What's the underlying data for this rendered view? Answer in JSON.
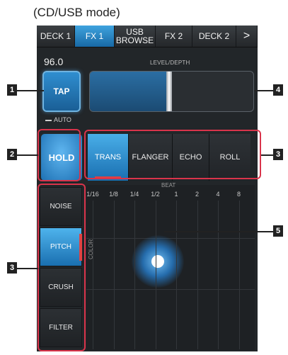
{
  "caption": "(CD/USB mode)",
  "tabs": [
    {
      "label": "DECK 1"
    },
    {
      "label": "FX 1"
    },
    {
      "label": "USB BROWSE"
    },
    {
      "label": "FX 2"
    },
    {
      "label": "DECK 2"
    },
    {
      "label": ">"
    }
  ],
  "bpm": "96.0",
  "tap_label": "TAP",
  "auto_label": "AUTO",
  "level_depth": {
    "label": "LEVEL/DEPTH",
    "value_fraction": 0.47
  },
  "hold_label": "HOLD",
  "fx_types": [
    {
      "label": "TRANS",
      "active": true
    },
    {
      "label": "FLANGER",
      "active": false
    },
    {
      "label": "ECHO",
      "active": false
    },
    {
      "label": "ROLL",
      "active": false
    }
  ],
  "side_fx": [
    {
      "label": "NOISE",
      "active": false
    },
    {
      "label": "PITCH",
      "active": true
    },
    {
      "label": "CRUSH",
      "active": false
    },
    {
      "label": "FILTER",
      "active": false
    }
  ],
  "beat_label": "BEAT",
  "beats": [
    "1/16",
    "1/8",
    "1/4",
    "1/2",
    "1",
    "2",
    "4",
    "8"
  ],
  "color_label": "COLOR",
  "callouts": [
    "1",
    "2",
    "3",
    "3",
    "4",
    "5"
  ],
  "colors": {
    "accent": "#2a8fd6",
    "highlight": "#d9344b",
    "panel": "#222629"
  }
}
